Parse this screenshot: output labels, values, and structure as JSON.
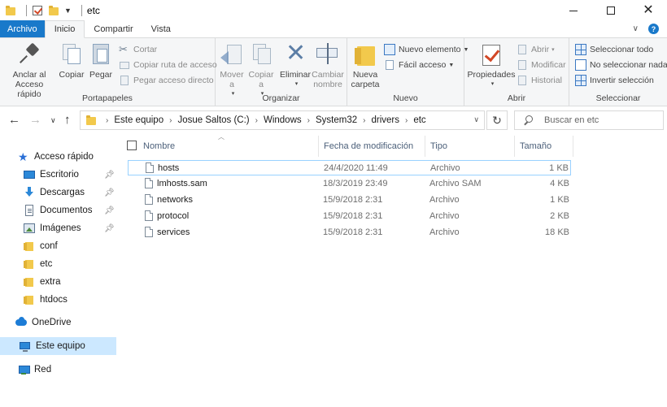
{
  "window": {
    "title": "etc"
  },
  "tabs": [
    {
      "label": "Archivo"
    },
    {
      "label": "Inicio"
    },
    {
      "label": "Compartir"
    },
    {
      "label": "Vista"
    }
  ],
  "ribbon": {
    "portapapeles": {
      "label": "Portapapeles",
      "pin": "Anclar al Acceso rápido",
      "copy": "Copiar",
      "paste": "Pegar",
      "cut": "Cortar",
      "copy_path": "Copiar ruta de acceso",
      "paste_shortcut": "Pegar acceso directo"
    },
    "organizar": {
      "label": "Organizar",
      "move": "Mover a",
      "copy_to": "Copiar a",
      "delete": "Eliminar",
      "rename": "Cambiar nombre"
    },
    "nuevo": {
      "label": "Nuevo",
      "new_folder": "Nueva carpeta",
      "new_item": "Nuevo elemento",
      "easy_access": "Fácil acceso"
    },
    "abrir": {
      "label": "Abrir",
      "properties": "Propiedades",
      "open": "Abrir",
      "edit": "Modificar",
      "history": "Historial"
    },
    "seleccionar": {
      "label": "Seleccionar",
      "select_all": "Seleccionar todo",
      "select_none": "No seleccionar nada",
      "invert": "Invertir selección"
    }
  },
  "address": {
    "crumbs": [
      "Este equipo",
      "Josue Saltos (C:)",
      "Windows",
      "System32",
      "drivers",
      "etc"
    ],
    "search_placeholder": "Buscar en etc"
  },
  "nav": {
    "quick_access": "Acceso rápido",
    "items": [
      {
        "label": "Escritorio",
        "icon": "desktop-icon",
        "pinned": true
      },
      {
        "label": "Descargas",
        "icon": "downloads-icon",
        "pinned": true
      },
      {
        "label": "Documentos",
        "icon": "documents-icon",
        "pinned": true
      },
      {
        "label": "Imágenes",
        "icon": "pictures-icon",
        "pinned": true
      },
      {
        "label": "conf",
        "icon": "folder-icon",
        "pinned": false
      },
      {
        "label": "etc",
        "icon": "folder-icon",
        "pinned": false
      },
      {
        "label": "extra",
        "icon": "folder-icon",
        "pinned": false
      },
      {
        "label": "htdocs",
        "icon": "folder-icon",
        "pinned": false
      }
    ],
    "onedrive": "OneDrive",
    "this_pc": "Este equipo",
    "network": "Red"
  },
  "columns": {
    "name": "Nombre",
    "date": "Fecha de modificación",
    "type": "Tipo",
    "size": "Tamaño"
  },
  "files": [
    {
      "name": "hosts",
      "date": "24/4/2020 11:49",
      "type": "Archivo",
      "size": "1 KB",
      "selected": true
    },
    {
      "name": "lmhosts.sam",
      "date": "18/3/2019 23:49",
      "type": "Archivo SAM",
      "size": "4 KB",
      "selected": false
    },
    {
      "name": "networks",
      "date": "15/9/2018 2:31",
      "type": "Archivo",
      "size": "1 KB",
      "selected": false
    },
    {
      "name": "protocol",
      "date": "15/9/2018 2:31",
      "type": "Archivo",
      "size": "2 KB",
      "selected": false
    },
    {
      "name": "services",
      "date": "15/9/2018 2:31",
      "type": "Archivo",
      "size": "18 KB",
      "selected": false
    }
  ],
  "colors": {
    "accent": "#1979ca",
    "selection": "#cce8ff",
    "folder": "#f2c94c"
  }
}
